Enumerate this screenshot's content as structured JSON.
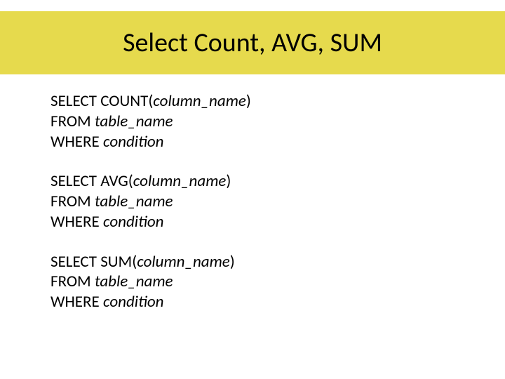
{
  "title": "Select Count, AVG, SUM",
  "blocks": [
    {
      "select_kw": "SELECT COUNT(",
      "select_arg": "column_name",
      "select_close": ")",
      "from_kw": "FROM ",
      "from_arg": "table_name",
      "where_kw": "WHERE ",
      "where_arg": "condition"
    },
    {
      "select_kw": "SELECT AVG(",
      "select_arg": "column_name",
      "select_close": ")",
      "from_kw": "FROM ",
      "from_arg": "table_name",
      "where_kw": "WHERE ",
      "where_arg": "condition"
    },
    {
      "select_kw": "SELECT SUM(",
      "select_arg": "column_name",
      "select_close": ")",
      "from_kw": "FROM ",
      "from_arg": "table_name",
      "where_kw": "WHERE ",
      "where_arg": "condition"
    }
  ]
}
